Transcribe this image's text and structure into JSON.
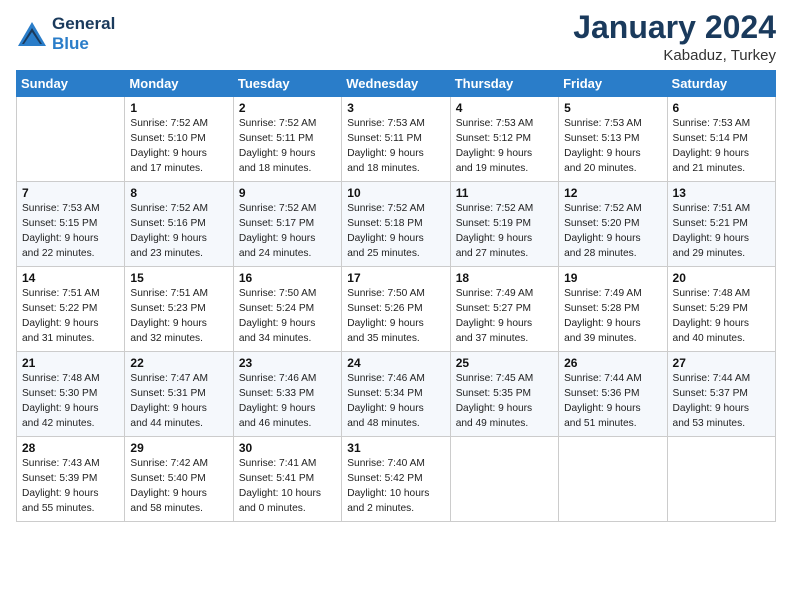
{
  "header": {
    "logo_line1": "General",
    "logo_line2": "Blue",
    "month": "January 2024",
    "location": "Kabaduz, Turkey"
  },
  "weekdays": [
    "Sunday",
    "Monday",
    "Tuesday",
    "Wednesday",
    "Thursday",
    "Friday",
    "Saturday"
  ],
  "weeks": [
    [
      {
        "day": "",
        "info": ""
      },
      {
        "day": "1",
        "info": "Sunrise: 7:52 AM\nSunset: 5:10 PM\nDaylight: 9 hours\nand 17 minutes."
      },
      {
        "day": "2",
        "info": "Sunrise: 7:52 AM\nSunset: 5:11 PM\nDaylight: 9 hours\nand 18 minutes."
      },
      {
        "day": "3",
        "info": "Sunrise: 7:53 AM\nSunset: 5:11 PM\nDaylight: 9 hours\nand 18 minutes."
      },
      {
        "day": "4",
        "info": "Sunrise: 7:53 AM\nSunset: 5:12 PM\nDaylight: 9 hours\nand 19 minutes."
      },
      {
        "day": "5",
        "info": "Sunrise: 7:53 AM\nSunset: 5:13 PM\nDaylight: 9 hours\nand 20 minutes."
      },
      {
        "day": "6",
        "info": "Sunrise: 7:53 AM\nSunset: 5:14 PM\nDaylight: 9 hours\nand 21 minutes."
      }
    ],
    [
      {
        "day": "7",
        "info": "Sunrise: 7:53 AM\nSunset: 5:15 PM\nDaylight: 9 hours\nand 22 minutes."
      },
      {
        "day": "8",
        "info": "Sunrise: 7:52 AM\nSunset: 5:16 PM\nDaylight: 9 hours\nand 23 minutes."
      },
      {
        "day": "9",
        "info": "Sunrise: 7:52 AM\nSunset: 5:17 PM\nDaylight: 9 hours\nand 24 minutes."
      },
      {
        "day": "10",
        "info": "Sunrise: 7:52 AM\nSunset: 5:18 PM\nDaylight: 9 hours\nand 25 minutes."
      },
      {
        "day": "11",
        "info": "Sunrise: 7:52 AM\nSunset: 5:19 PM\nDaylight: 9 hours\nand 27 minutes."
      },
      {
        "day": "12",
        "info": "Sunrise: 7:52 AM\nSunset: 5:20 PM\nDaylight: 9 hours\nand 28 minutes."
      },
      {
        "day": "13",
        "info": "Sunrise: 7:51 AM\nSunset: 5:21 PM\nDaylight: 9 hours\nand 29 minutes."
      }
    ],
    [
      {
        "day": "14",
        "info": "Sunrise: 7:51 AM\nSunset: 5:22 PM\nDaylight: 9 hours\nand 31 minutes."
      },
      {
        "day": "15",
        "info": "Sunrise: 7:51 AM\nSunset: 5:23 PM\nDaylight: 9 hours\nand 32 minutes."
      },
      {
        "day": "16",
        "info": "Sunrise: 7:50 AM\nSunset: 5:24 PM\nDaylight: 9 hours\nand 34 minutes."
      },
      {
        "day": "17",
        "info": "Sunrise: 7:50 AM\nSunset: 5:26 PM\nDaylight: 9 hours\nand 35 minutes."
      },
      {
        "day": "18",
        "info": "Sunrise: 7:49 AM\nSunset: 5:27 PM\nDaylight: 9 hours\nand 37 minutes."
      },
      {
        "day": "19",
        "info": "Sunrise: 7:49 AM\nSunset: 5:28 PM\nDaylight: 9 hours\nand 39 minutes."
      },
      {
        "day": "20",
        "info": "Sunrise: 7:48 AM\nSunset: 5:29 PM\nDaylight: 9 hours\nand 40 minutes."
      }
    ],
    [
      {
        "day": "21",
        "info": "Sunrise: 7:48 AM\nSunset: 5:30 PM\nDaylight: 9 hours\nand 42 minutes."
      },
      {
        "day": "22",
        "info": "Sunrise: 7:47 AM\nSunset: 5:31 PM\nDaylight: 9 hours\nand 44 minutes."
      },
      {
        "day": "23",
        "info": "Sunrise: 7:46 AM\nSunset: 5:33 PM\nDaylight: 9 hours\nand 46 minutes."
      },
      {
        "day": "24",
        "info": "Sunrise: 7:46 AM\nSunset: 5:34 PM\nDaylight: 9 hours\nand 48 minutes."
      },
      {
        "day": "25",
        "info": "Sunrise: 7:45 AM\nSunset: 5:35 PM\nDaylight: 9 hours\nand 49 minutes."
      },
      {
        "day": "26",
        "info": "Sunrise: 7:44 AM\nSunset: 5:36 PM\nDaylight: 9 hours\nand 51 minutes."
      },
      {
        "day": "27",
        "info": "Sunrise: 7:44 AM\nSunset: 5:37 PM\nDaylight: 9 hours\nand 53 minutes."
      }
    ],
    [
      {
        "day": "28",
        "info": "Sunrise: 7:43 AM\nSunset: 5:39 PM\nDaylight: 9 hours\nand 55 minutes."
      },
      {
        "day": "29",
        "info": "Sunrise: 7:42 AM\nSunset: 5:40 PM\nDaylight: 9 hours\nand 58 minutes."
      },
      {
        "day": "30",
        "info": "Sunrise: 7:41 AM\nSunset: 5:41 PM\nDaylight: 10 hours\nand 0 minutes."
      },
      {
        "day": "31",
        "info": "Sunrise: 7:40 AM\nSunset: 5:42 PM\nDaylight: 10 hours\nand 2 minutes."
      },
      {
        "day": "",
        "info": ""
      },
      {
        "day": "",
        "info": ""
      },
      {
        "day": "",
        "info": ""
      }
    ]
  ]
}
